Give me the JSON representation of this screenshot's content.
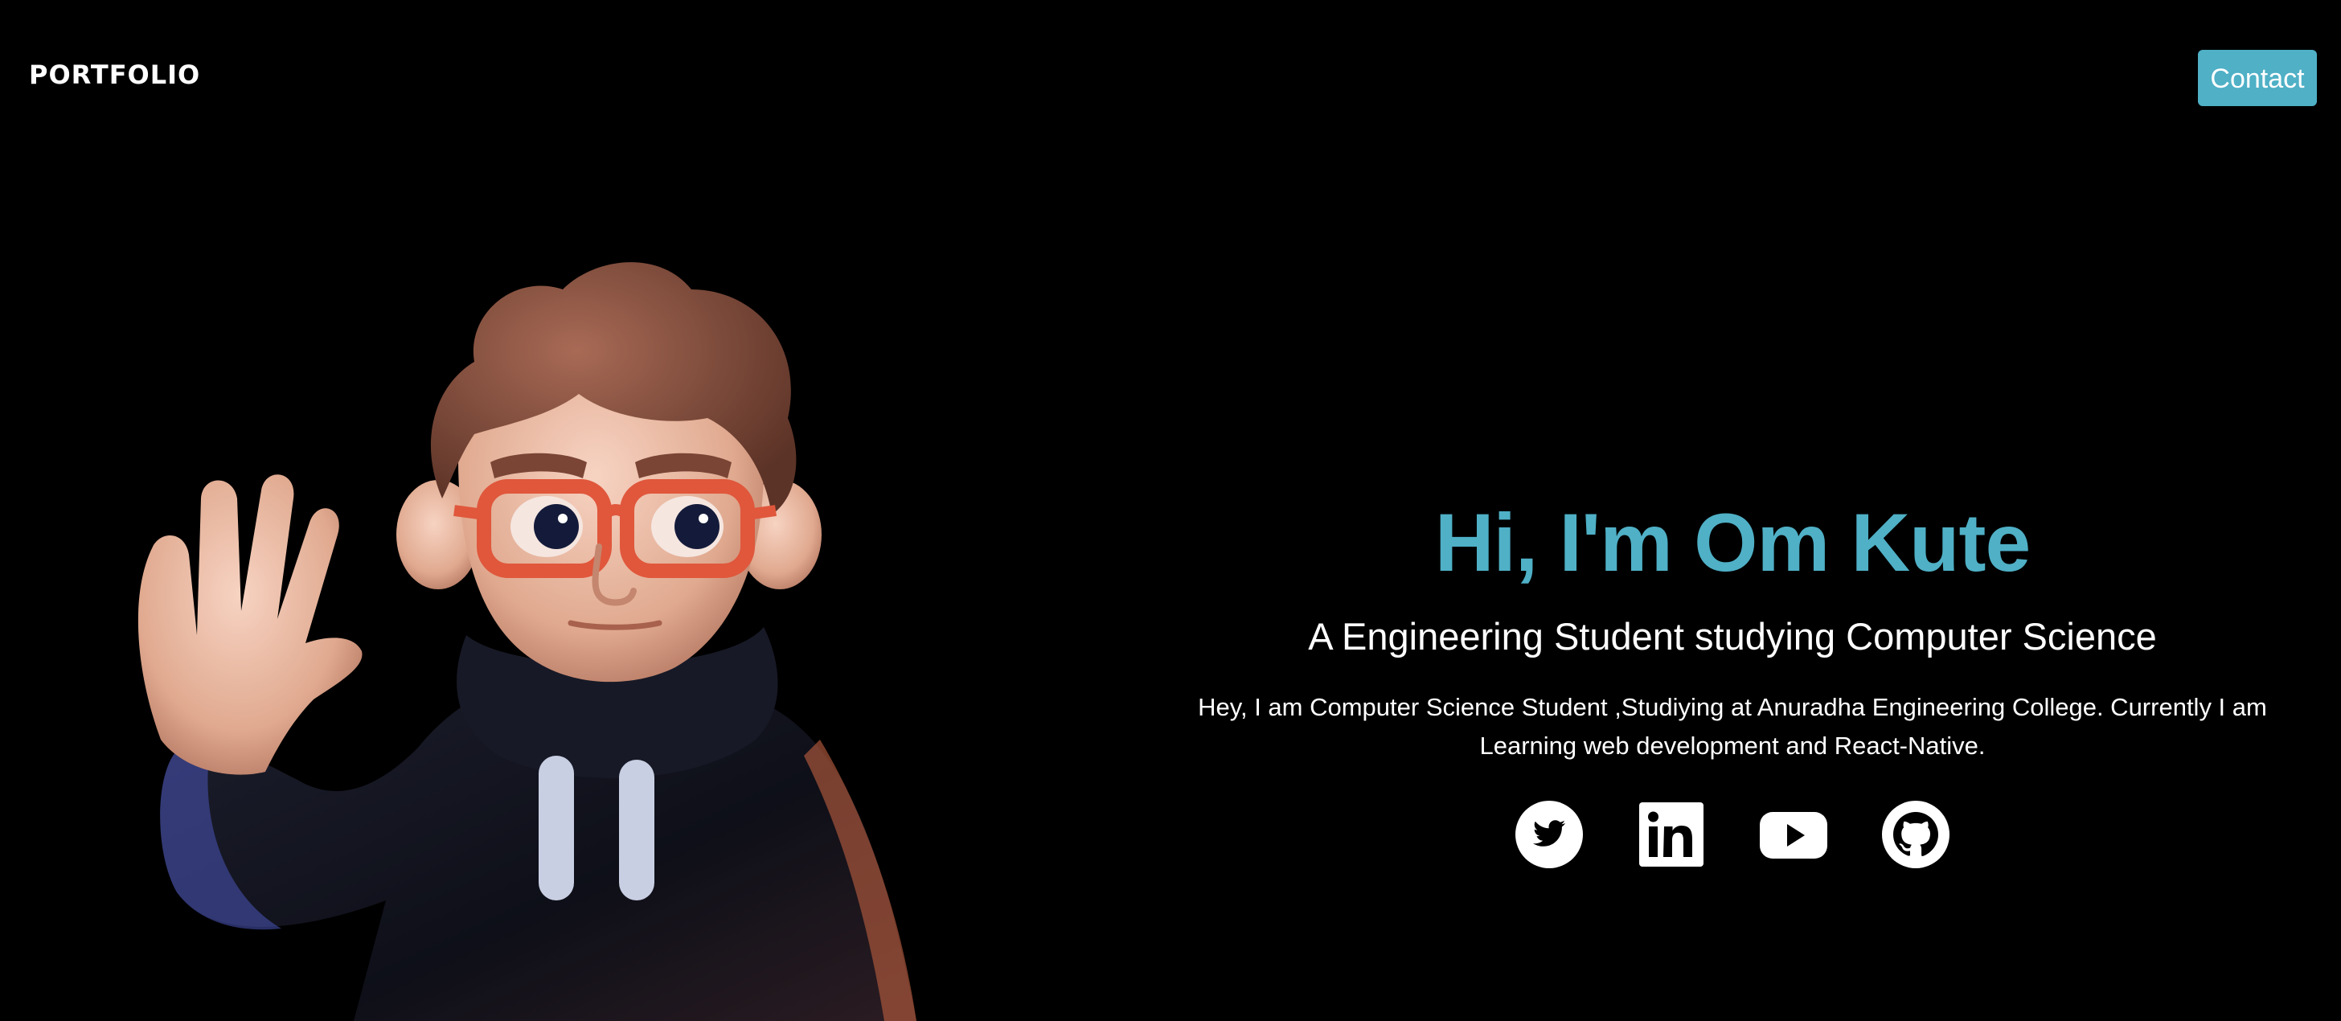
{
  "header": {
    "brand": "PORTFOLIO",
    "contact_label": "Contact"
  },
  "hero": {
    "title": "Hi, I'm Om Kute",
    "subtitle": "A Engineering Student studying Computer Science",
    "description": "Hey, I am Computer Science Student ,Studiying at Anuradha Engineering College. Currently I am Learning web development and React-Native."
  },
  "socials": [
    {
      "icon": "twitter-icon"
    },
    {
      "icon": "linkedin-icon"
    },
    {
      "icon": "youtube-icon"
    },
    {
      "icon": "github-icon"
    }
  ],
  "illustration": {
    "icon": "waving-avatar-illustration"
  },
  "colors": {
    "background": "#000000",
    "accent": "#4fb0c6",
    "text": "#ffffff"
  }
}
